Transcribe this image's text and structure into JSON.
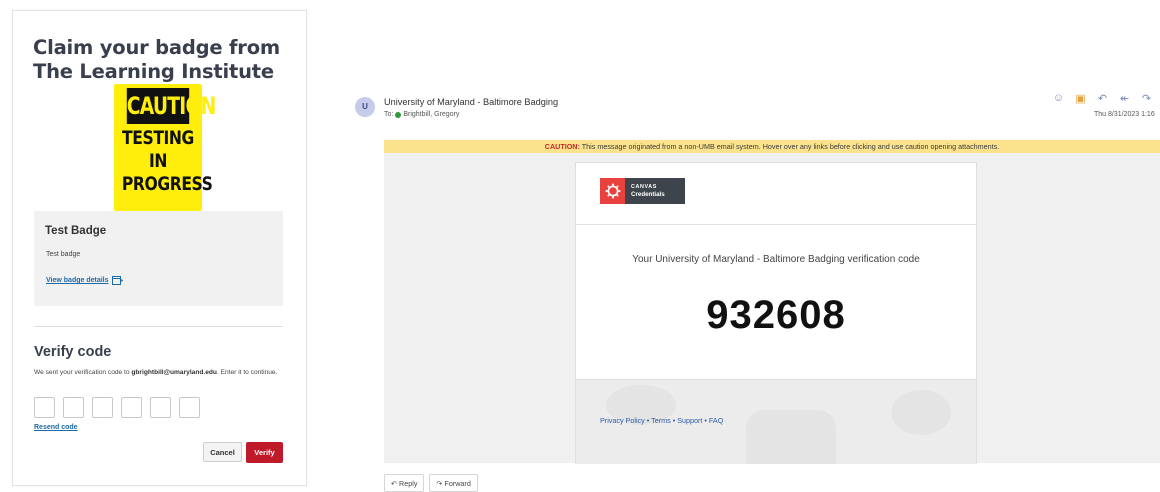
{
  "claim": {
    "title": "Claim your badge from The Learning Institute",
    "badge_image": {
      "line1": "CAUTION",
      "line2": "TESTING",
      "line3": "IN",
      "line4": "PROGRESS"
    },
    "badge_name": "Test Badge",
    "badge_description": "Test badge",
    "view_details_link": "View badge details",
    "verify_heading": "Verify code",
    "verify_text_prefix": "We sent your verification code to ",
    "verify_email": "gbrightbill@umaryland.edu",
    "verify_text_suffix": ". Enter it to continue.",
    "resend_link": "Resend code",
    "cancel_label": "Cancel",
    "verify_label": "Verify"
  },
  "email": {
    "avatar_letter": "U",
    "sender": "University of Maryland - Baltimore Badging",
    "to_label": "To:",
    "recipient": "Brightbill, Gregory",
    "date": "Thu 8/31/2023 1:16",
    "caution_label": "CAUTION:",
    "caution_text": " This message originated from a non-UMB email system. Hover over any links before clicking and use caution opening attachments.",
    "logo_top": "CANVAS",
    "logo_bottom": "Credentials",
    "message": "Your University of Maryland - Baltimore Badging verification code",
    "code": "932608",
    "footer_links": {
      "privacy": "Privacy Policy",
      "terms": "Terms",
      "support": "Support",
      "faq": "FAQ",
      "separator": " • "
    },
    "reply_label": "Reply",
    "forward_label": "Forward"
  }
}
